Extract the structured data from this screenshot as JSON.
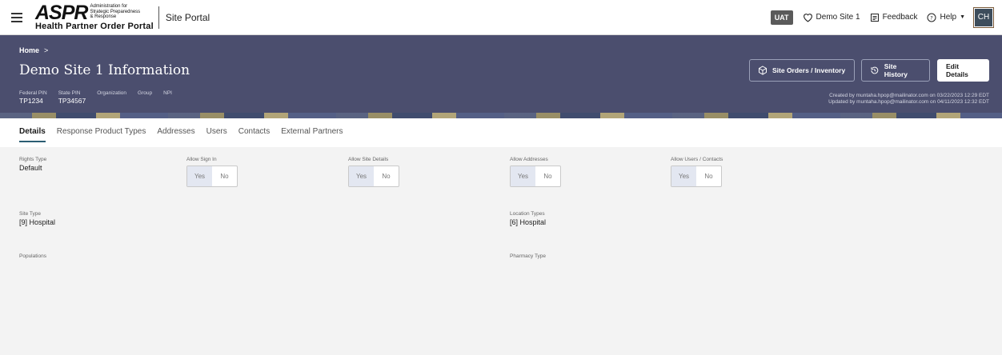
{
  "topbar": {
    "logo_main": "ASPR",
    "logo_sub": "Administration for Strategic Preparedness & Response",
    "logo_portal": "Health Partner Order Portal",
    "site_portal": "Site Portal",
    "env_badge": "UAT",
    "site_label": "Demo Site 1",
    "feedback_label": "Feedback",
    "help_label": "Help",
    "user_initials": "CH"
  },
  "header": {
    "breadcrumb_home": "Home",
    "breadcrumb_sep": ">",
    "title": "Demo Site 1 Information",
    "orders_button": "Site Orders / Inventory",
    "history_button": "Site History",
    "edit_button": "Edit Details",
    "meta": [
      {
        "label": "Federal PIN",
        "value": "TP1234"
      },
      {
        "label": "State PIN",
        "value": "TP34567"
      },
      {
        "label": "Organization",
        "value": ""
      },
      {
        "label": "Group",
        "value": ""
      },
      {
        "label": "NPI",
        "value": ""
      }
    ],
    "created": "Created by muntaha.hpop@mailinator.com on 03/22/2023 12:29 EDT",
    "updated": "Updated by muntaha.hpop@mailinator.com on 04/11/2023 12:32 EDT"
  },
  "tabs": [
    "Details",
    "Response Product Types",
    "Addresses",
    "Users",
    "Contacts",
    "External Partners"
  ],
  "details": {
    "rights_type_label": "Rights Type",
    "rights_type_value": "Default",
    "toggle_yes": "Yes",
    "toggle_no": "No",
    "allow_sign_in_label": "Allow Sign In",
    "allow_site_details_label": "Allow Site Details",
    "allow_addresses_label": "Allow Addresses",
    "allow_users_contacts_label": "Allow Users / Contacts",
    "site_type_label": "Site Type",
    "site_type_value": "[9] Hospital",
    "location_types_label": "Location Types",
    "location_types_value": "[6] Hospital",
    "populations_label": "Populations",
    "pharmacy_type_label": "Pharmacy Type"
  }
}
